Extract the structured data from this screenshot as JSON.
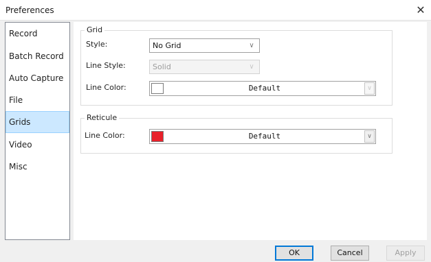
{
  "window": {
    "title": "Preferences",
    "close_glyph": "✕"
  },
  "sidebar": {
    "items": [
      {
        "label": "Record",
        "selected": false
      },
      {
        "label": "Batch Record",
        "selected": false
      },
      {
        "label": "Auto Capture",
        "selected": false
      },
      {
        "label": "File",
        "selected": false
      },
      {
        "label": "Grids",
        "selected": true
      },
      {
        "label": "Video",
        "selected": false
      },
      {
        "label": "Misc",
        "selected": false
      }
    ]
  },
  "grid_group": {
    "title": "Grid",
    "style_label": "Style:",
    "style_value": "No Grid",
    "line_style_label": "Line Style:",
    "line_style_value": "Solid",
    "line_style_enabled": false,
    "line_color_label": "Line Color:",
    "line_color_value": "Default",
    "line_color_swatch": "#ffffff",
    "line_color_enabled": false
  },
  "reticule_group": {
    "title": "Reticule",
    "line_color_label": "Line Color:",
    "line_color_value": "Default",
    "line_color_swatch": "#e8202a"
  },
  "buttons": {
    "ok": "OK",
    "cancel": "Cancel",
    "apply": "Apply",
    "apply_enabled": false
  },
  "icons": {
    "combo_arrow": "∨",
    "close": "close-icon"
  }
}
